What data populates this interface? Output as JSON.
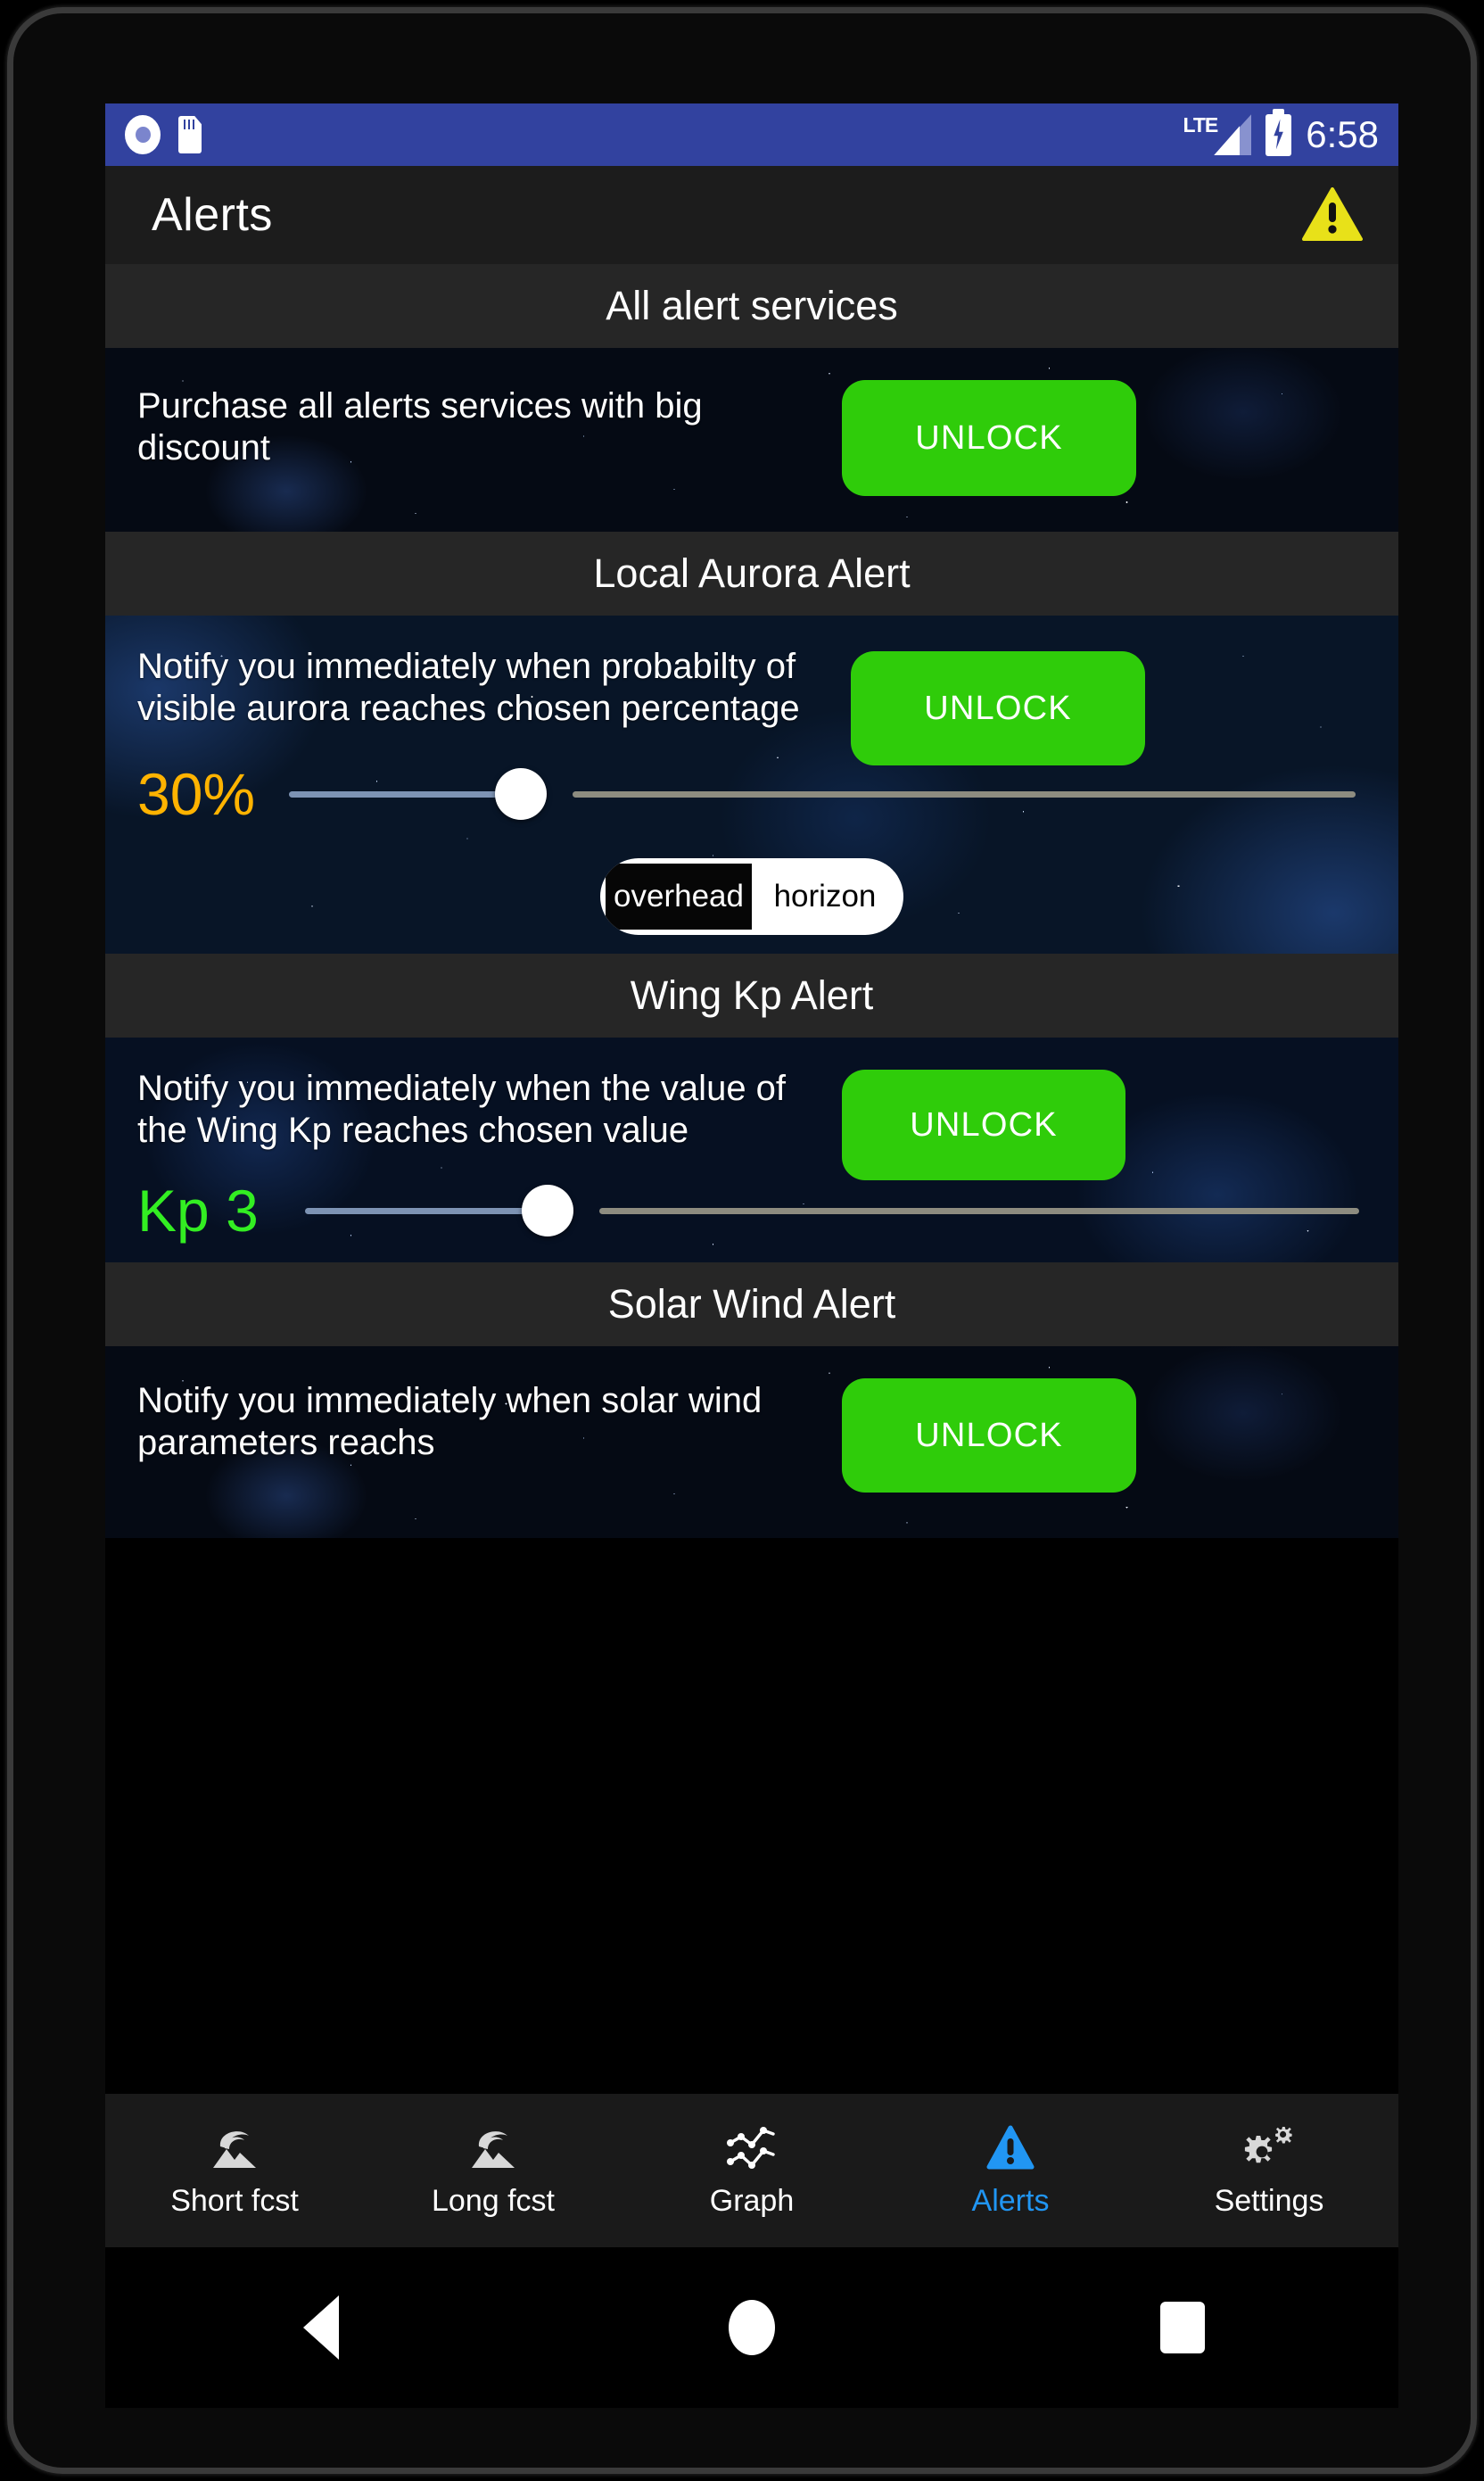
{
  "status_bar": {
    "icons": [
      "record-icon",
      "sd-card-icon"
    ],
    "network": "LTE",
    "clock": "6:58",
    "background_color": "#32429f"
  },
  "app_bar": {
    "title": "Alerts",
    "icon": "warning-triangle-icon",
    "icon_color": "#e8e119"
  },
  "sections": [
    {
      "header": "All alert services",
      "description": "Purchase all alerts services with big discount",
      "unlock_label": "UNLOCK"
    },
    {
      "header": "Local Aurora Alert",
      "description": "Notify you immediately when probabilty of visible aurora reaches chosen percentage",
      "unlock_label": "UNLOCK",
      "slider": {
        "value_label": "30%",
        "value": 30,
        "min": 0,
        "max": 100,
        "value_color": "#ffb300"
      },
      "toggle": {
        "options": [
          "overhead",
          "horizon"
        ],
        "selected": "horizon"
      }
    },
    {
      "header": "Wing Kp Alert",
      "description": "Notify you immediately when the value of the Wing Kp reaches chosen value",
      "unlock_label": "UNLOCK",
      "slider": {
        "value_label": "Kp 3",
        "value": 3,
        "min": 0,
        "max": 9,
        "value_color": "#33ee22"
      }
    },
    {
      "header": "Solar Wind Alert",
      "description": "Notify you immediately when solar wind parameters reachs",
      "unlock_label": "UNLOCK"
    }
  ],
  "bottom_nav": {
    "active": "Alerts",
    "items": [
      {
        "label": "Short fcst",
        "icon": "aurora-mountain-icon"
      },
      {
        "label": "Long fcst",
        "icon": "aurora-mountain-icon"
      },
      {
        "label": "Graph",
        "icon": "line-chart-icon"
      },
      {
        "label": "Alerts",
        "icon": "warning-triangle-icon"
      },
      {
        "label": "Settings",
        "icon": "gear-icon"
      }
    ],
    "active_color": "#2196f3"
  },
  "android_nav": {
    "back": "back-button",
    "home": "home-button",
    "recents": "recents-button"
  },
  "theme": {
    "unlock_green": "#2fcc0a",
    "section_header_bg": "#262626",
    "app_bar_bg": "#1c1c1c"
  }
}
